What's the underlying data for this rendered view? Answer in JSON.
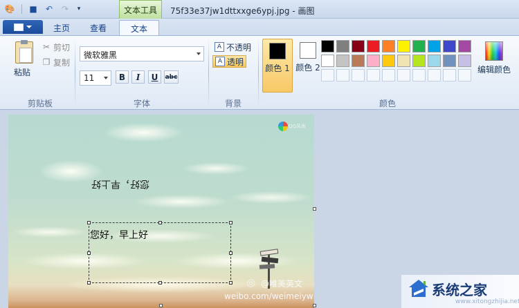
{
  "window": {
    "context_tab": "文本工具",
    "title": "75f33e37jw1dttxxge6ypj.jpg - 画图"
  },
  "tabs": [
    {
      "label": "主页"
    },
    {
      "label": "查看"
    },
    {
      "label": "文本",
      "active": true
    }
  ],
  "clipboard": {
    "paste_label": "粘贴",
    "cut_label": "剪切",
    "copy_label": "复制",
    "group_label": "剪贴板"
  },
  "font": {
    "family_value": "微软雅黑",
    "size_value": "11",
    "bold_label": "B",
    "italic_label": "I",
    "underline_label": "U",
    "strike_label": "abc",
    "group_label": "字体"
  },
  "background": {
    "opaque_label": "不透明",
    "transparent_label": "透明",
    "selected": "透明",
    "group_label": "背景"
  },
  "colors": {
    "color1_label": "颜色 1",
    "color1_value": "#000000",
    "color2_label": "颜色 2",
    "color2_value": "#ffffff",
    "edit_label": "编辑颜色",
    "group_label": "颜色",
    "palette": [
      "#000000",
      "#7f7f7f",
      "#880015",
      "#ed1c24",
      "#ff7f27",
      "#fff200",
      "#22b14c",
      "#00a2e8",
      "#3f48cc",
      "#a349a4",
      "#ffffff",
      "#c3c3c3",
      "#b97a57",
      "#ffaec9",
      "#ffc90e",
      "#efe4b0",
      "#b5e61d",
      "#99d9ea",
      "#7092be",
      "#c8bfe7",
      "",
      "",
      "",
      "",
      "",
      "",
      "",
      "",
      "",
      ""
    ]
  },
  "canvas": {
    "qq_logo_text": "QQ风尚",
    "mirrored_text": "您好，早上好",
    "textbox_text": "您好，早上好",
    "weibo_name": "@唯美英文",
    "weibo_url": "weibo.com/weimeiyw"
  },
  "watermark": {
    "text": "系统之家",
    "sub": "www.xitongzhijia.net"
  },
  "icons": {
    "paint_app": "paint-app-icon",
    "save": "save-icon",
    "undo": "undo-icon",
    "redo": "redo-icon"
  }
}
